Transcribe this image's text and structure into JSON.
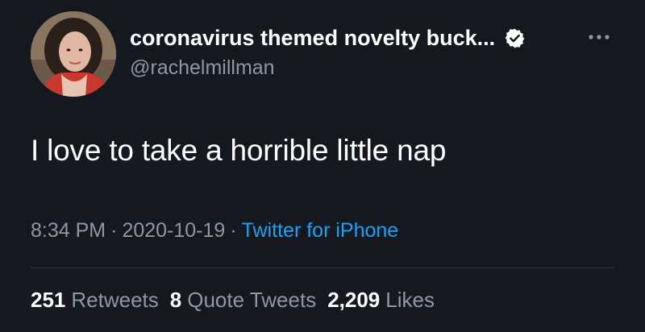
{
  "author": {
    "display_name": "coronavirus themed novelty buck...",
    "handle": "@rachelmillman",
    "verified": true
  },
  "tweet": {
    "text": "I love to take a horrible little nap"
  },
  "meta": {
    "time": "8:34 PM",
    "separator": "·",
    "date": "2020-10-19",
    "source": "Twitter for iPhone"
  },
  "stats": {
    "retweets_count": "251",
    "retweets_label": "Retweets",
    "quotes_count": "8",
    "quotes_label": "Quote Tweets",
    "likes_count": "2,209",
    "likes_label": "Likes"
  },
  "icons": {
    "verified": "verified-badge-icon",
    "more": "more-options-icon"
  },
  "colors": {
    "background": "#15181f",
    "text": "#ffffff",
    "muted": "#8b98a5",
    "link": "#1da1f2",
    "divider": "#2f3640"
  }
}
